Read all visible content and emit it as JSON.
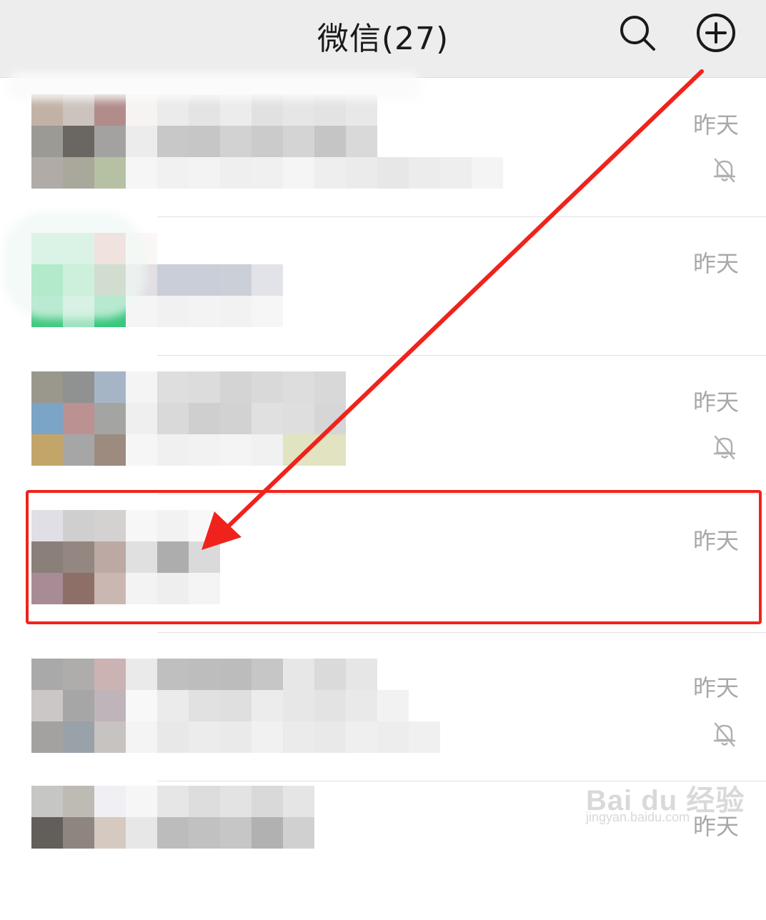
{
  "header": {
    "title": "微信(27)",
    "search_icon": "search-icon",
    "add_icon": "plus-circle-icon"
  },
  "chats": [
    {
      "time": "昨天",
      "muted": true
    },
    {
      "time": "昨天",
      "muted": false
    },
    {
      "time": "昨天",
      "muted": true
    },
    {
      "time": "昨天",
      "muted": false
    },
    {
      "time": "昨天",
      "muted": true
    },
    {
      "time": "昨天",
      "muted": false
    }
  ],
  "annotation": {
    "color": "#f0231c",
    "highlighted_row": 4
  },
  "watermark": {
    "logo": "Bai du 经验",
    "sub": "jingyan.baidu.com"
  },
  "colors": {
    "header_bg": "#ededed",
    "time_text": "#a8a8a8",
    "accent_red": "#f0231c"
  }
}
